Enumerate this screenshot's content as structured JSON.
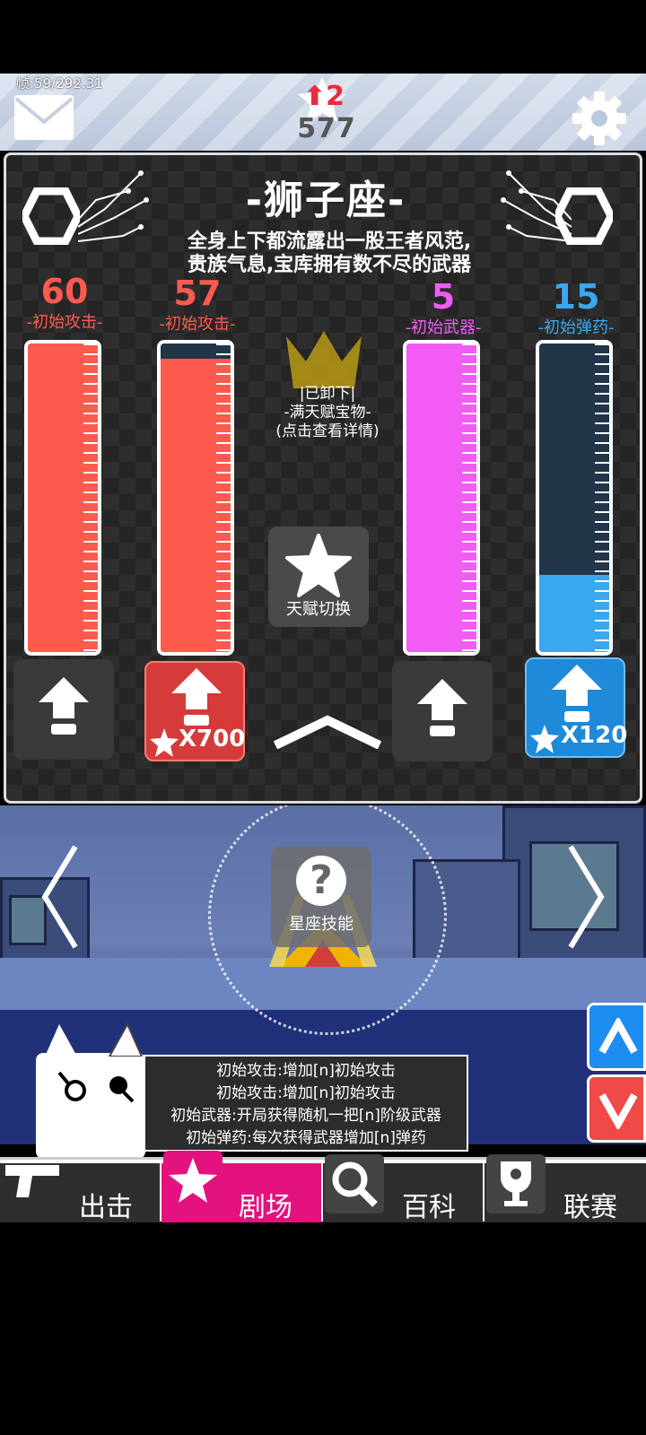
{
  "hud": {
    "fps": "帧:59/292.31",
    "rank_up": "2",
    "score": "577"
  },
  "panel": {
    "title": "-狮子座-",
    "desc_line1": "全身上下都流露出一股王者风范,",
    "desc_line2": "贵族气息,宝库拥有数不尽的武器",
    "stats": [
      {
        "value": "60",
        "label": "-初始攻击-",
        "color": "#ff5a4e",
        "level": 1.0
      },
      {
        "value": "57",
        "label": "-初始攻击-",
        "color": "#ff5a4e",
        "level": 0.95
      },
      {
        "value": "5",
        "label": "-初始武器-",
        "color": "#f25cf5",
        "level": 1.0
      },
      {
        "value": "15",
        "label": "-初始弹药-",
        "color": "#3aa8ee",
        "level": 0.25
      }
    ],
    "equip_line1": "|已卸下|",
    "equip_line2": "-满天赋宝物-",
    "equip_line3": "(点击查看详情)",
    "talent_switch": "天赋切换",
    "upgrade_costs": [
      "X700",
      "X120"
    ]
  },
  "scene": {
    "skill_label": "星座技能"
  },
  "info_lines": [
    "初始攻击:增加[n]初始攻击",
    "初始攻击:增加[n]初始攻击",
    "初始武器:开局获得随机一把[n]阶级武器",
    "初始弹药:每次获得武器增加[n]弹药"
  ],
  "nav": {
    "tabs": [
      "出击",
      "剧场",
      "百科",
      "联赛"
    ],
    "active": "剧场"
  },
  "icons": [
    "mail-icon",
    "star-icon",
    "gear-icon",
    "hexagon-icon",
    "crown-icon",
    "arrow-up-icon",
    "question-icon",
    "chevron-left-icon",
    "chevron-right-icon",
    "gun-icon",
    "search-icon",
    "trophy-icon",
    "male-icon",
    "female-icon"
  ]
}
